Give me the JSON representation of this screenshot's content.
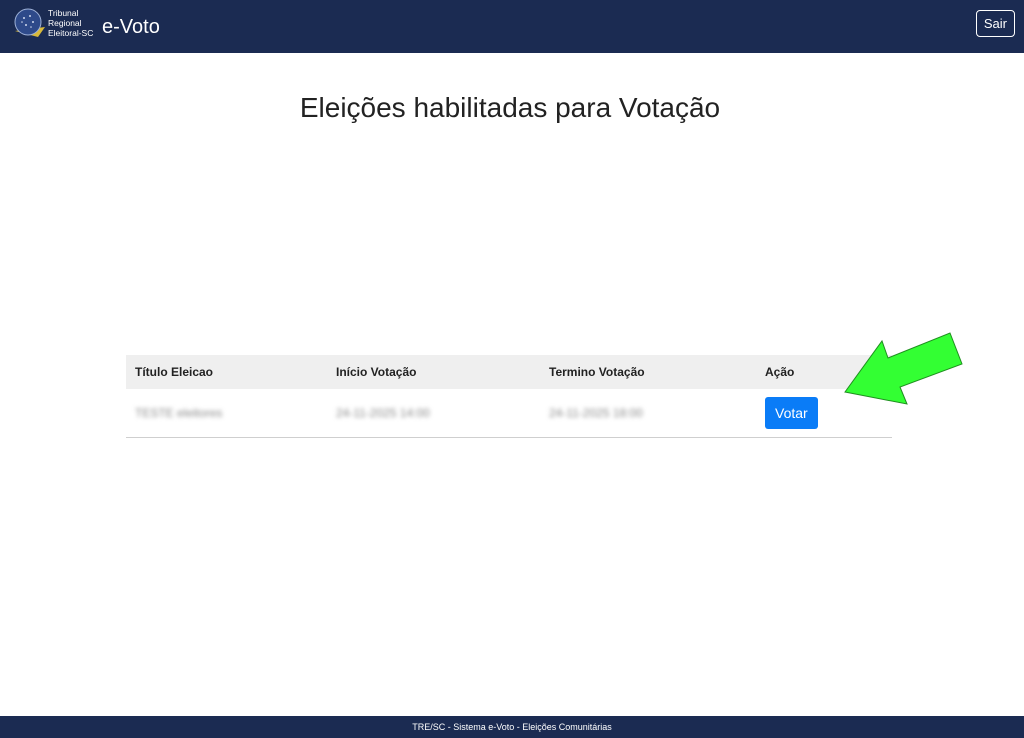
{
  "header": {
    "org_line1": "Tribunal",
    "org_line2": "Regional",
    "org_line3": "Eleitoral-SC",
    "app_title": "e-Voto",
    "logout_label": "Sair"
  },
  "main": {
    "title": "Eleições habilitadas para Votação"
  },
  "table": {
    "columns": [
      "Título Eleicao",
      "Início Votação",
      "Termino Votação",
      "Ação"
    ],
    "rows": [
      {
        "title": "TESTE eleitores",
        "start": "24-11-2025 14:00",
        "end": "24-11-2025 18:00",
        "action_label": "Votar"
      }
    ]
  },
  "footer": {
    "text": "TRE/SC - Sistema e-Voto - Eleições Comunitárias"
  },
  "colors": {
    "navbar": "#1b2b52",
    "vote_button": "#0a7cf7",
    "arrow": "#33ff33"
  }
}
